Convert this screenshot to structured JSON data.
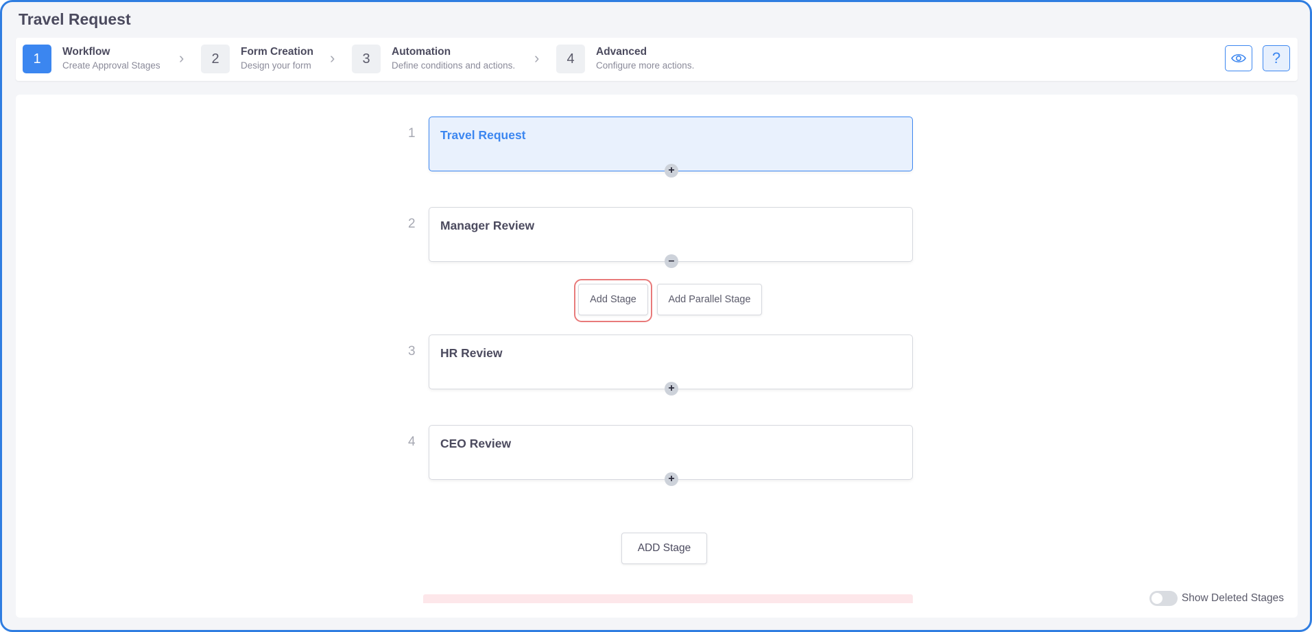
{
  "app": {
    "title": "Travel Request"
  },
  "steps": [
    {
      "num": "1",
      "title": "Workflow",
      "subtitle": "Create Approval Stages",
      "active": true
    },
    {
      "num": "2",
      "title": "Form Creation",
      "subtitle": "Design your form",
      "active": false
    },
    {
      "num": "3",
      "title": "Automation",
      "subtitle": "Define conditions and actions.",
      "active": false
    },
    {
      "num": "4",
      "title": "Advanced",
      "subtitle": "Configure more actions.",
      "active": false
    }
  ],
  "toolbar": {
    "preview_icon": "eye-icon",
    "help_icon": "question-icon"
  },
  "stages": [
    {
      "num": "1",
      "name": "Travel Request",
      "toggle": "+",
      "active": true
    },
    {
      "num": "2",
      "name": "Manager Review",
      "toggle": "–",
      "active": false
    },
    {
      "num": "3",
      "name": "HR Review",
      "toggle": "+",
      "active": false
    },
    {
      "num": "4",
      "name": "CEO Review",
      "toggle": "+",
      "active": false
    }
  ],
  "actions": {
    "add_stage": "Add Stage",
    "add_parallel_stage": "Add Parallel Stage",
    "add_stage_bottom": "ADD Stage"
  },
  "footer": {
    "show_deleted_label": "Show Deleted Stages",
    "show_deleted_on": false
  },
  "colors": {
    "accent": "#3b86f0",
    "highlight": "#e87a7a",
    "active_stage_bg": "#e9f1fd"
  }
}
